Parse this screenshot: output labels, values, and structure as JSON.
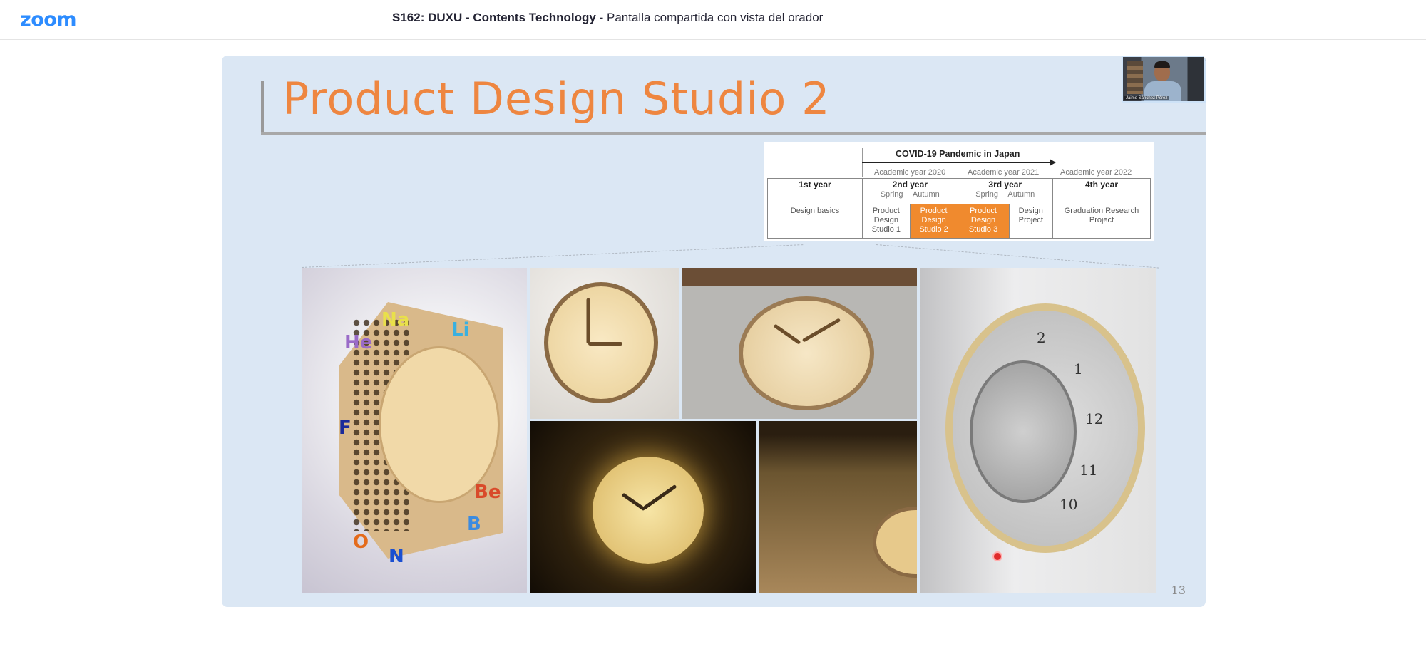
{
  "app": {
    "logo": "zoom",
    "meeting_title_bold": "S162: DUXU - Contents Technology",
    "meeting_title_rest": " - Pantalla compartida con vista del orador"
  },
  "slide": {
    "title": "Product Design Studio 2",
    "page_number": "13",
    "speaker_thumbnail_caption": "Jaime Sánchez Pérez",
    "curriculum": {
      "pandemic_label": "COVID-19 Pandemic in Japan",
      "academic_years": [
        "Academic year 2020",
        "Academic year 2021",
        "Academic year 2022"
      ],
      "headers": {
        "first": "1st year",
        "second": "2nd year",
        "third": "3rd year",
        "fourth": "4th year",
        "spring": "Spring",
        "autumn": "Autumn"
      },
      "cells": {
        "design_basics": "Design basics",
        "pds1": [
          "Product",
          "Design",
          "Studio 1"
        ],
        "pds2": [
          "Product",
          "Design",
          "Studio 2"
        ],
        "pds3": [
          "Product",
          "Design",
          "Studio 3"
        ],
        "design_project": [
          "Design",
          "Project"
        ],
        "graduation": [
          "Graduation Research",
          "Project"
        ]
      }
    },
    "clock_numbers": [
      "2",
      "1",
      "12",
      "11",
      "10"
    ]
  },
  "colors": {
    "zoom_blue": "#2d8cff",
    "title_orange": "#ee8640",
    "highlight_orange": "#f08a2e",
    "slide_background": "#dbe7f4"
  }
}
